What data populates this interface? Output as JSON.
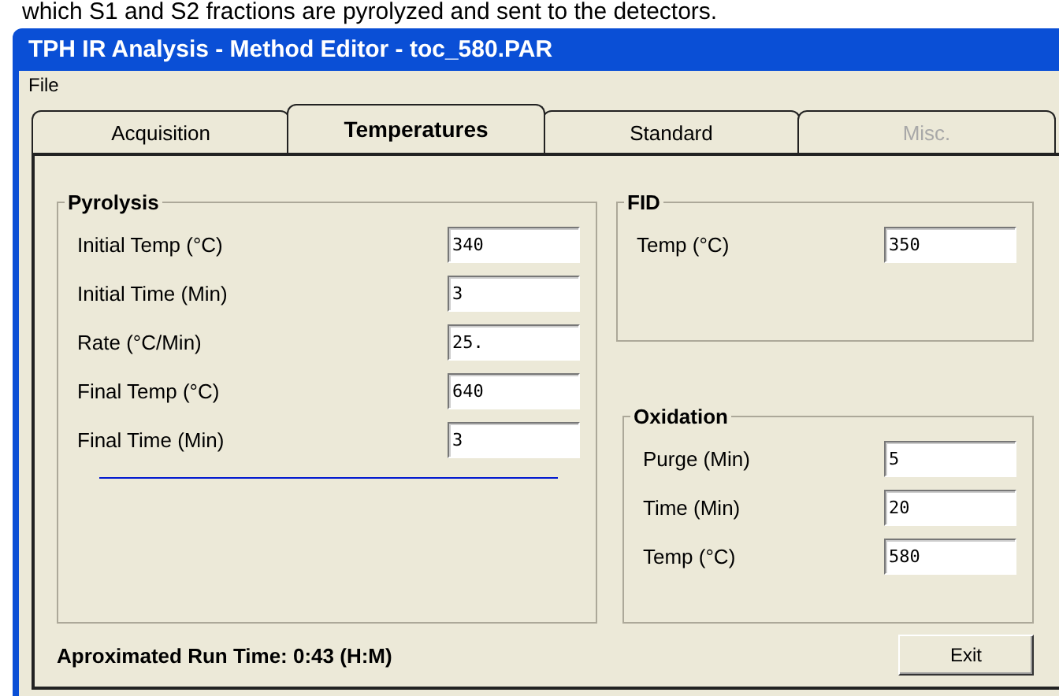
{
  "caption": "which S1 and S2 fractions are pyrolyzed and sent to the detectors.",
  "window": {
    "title": "TPH IR Analysis - Method Editor - toc_580.PAR"
  },
  "menu": [
    "File"
  ],
  "tabs": [
    {
      "label": "Acquisition",
      "selected": false,
      "disabled": false
    },
    {
      "label": "Temperatures",
      "selected": true,
      "disabled": false
    },
    {
      "label": "Standard",
      "selected": false,
      "disabled": false
    },
    {
      "label": "Misc.",
      "selected": false,
      "disabled": true
    }
  ],
  "pyrolysis": {
    "title": "Pyrolysis",
    "fields": [
      {
        "label": "Initial Temp (°C)",
        "value": "340"
      },
      {
        "label": "Initial Time (Min)",
        "value": "3"
      },
      {
        "label": "Rate  (°C/Min)",
        "value": "25."
      },
      {
        "label": "Final Temp  (°C)",
        "value": "640"
      },
      {
        "label": "Final Time (Min)",
        "value": "3"
      }
    ]
  },
  "fid": {
    "title": "FID",
    "fields": [
      {
        "label": "Temp (°C)",
        "value": "350"
      }
    ]
  },
  "oxidation": {
    "title": "Oxidation",
    "fields": [
      {
        "label": "Purge (Min)",
        "value": "5"
      },
      {
        "label": "Time (Min)",
        "value": "20"
      },
      {
        "label": "Temp  (°C)",
        "value": "580"
      }
    ]
  },
  "run_time": "Aproximated Run Time: 0:43 (H:M)",
  "exit_button": "Exit"
}
